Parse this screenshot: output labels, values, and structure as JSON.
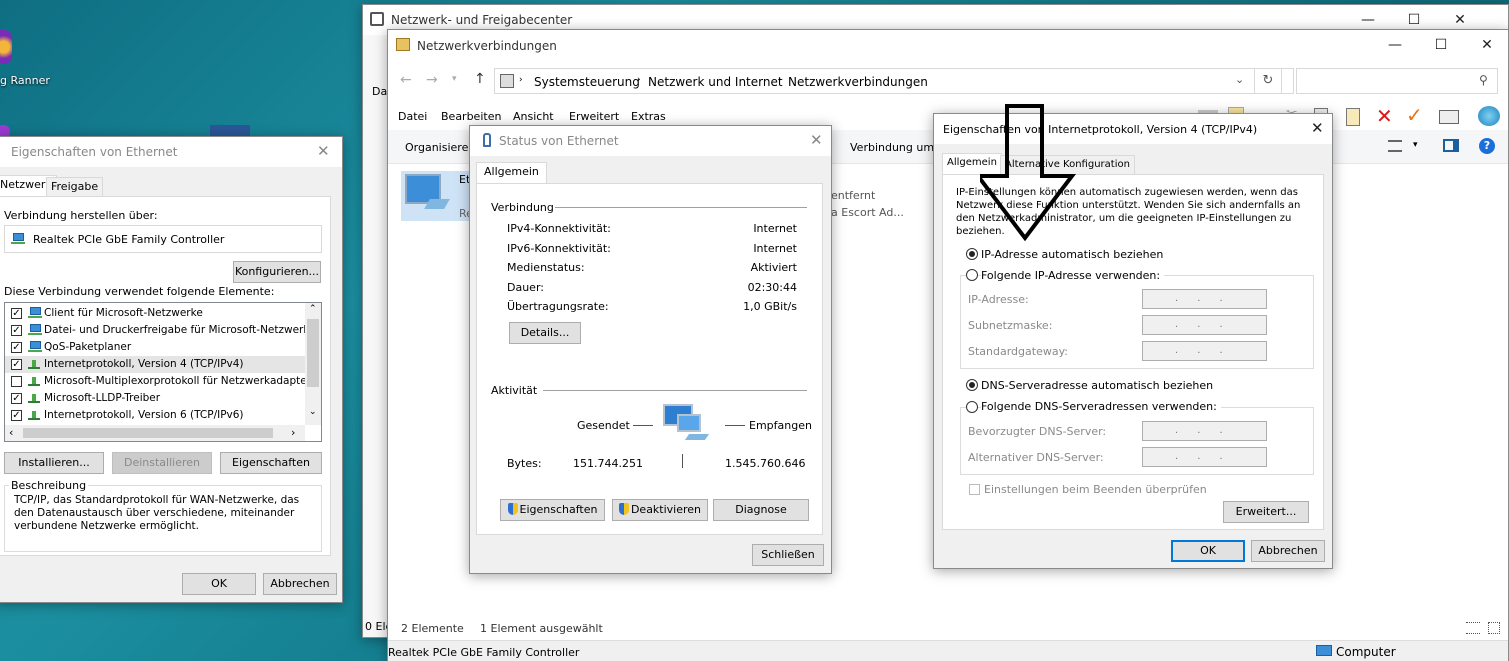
{
  "desktop": {
    "icon_label": "g Ranner"
  },
  "nfc": {
    "title": "Netzwerk- und Freigabecenter",
    "clip_text": "Dat",
    "footer_text": "0 Ele"
  },
  "nv": {
    "title": "Netzwerkverbindungen",
    "breadcrumb": [
      "Systemsteuerung",
      "Netzwerk und Internet",
      "Netzwerkverbindungen"
    ],
    "search_placeholder": "",
    "menu": [
      "Datei",
      "Bearbeiten",
      "Ansicht",
      "Erweitert",
      "Extras"
    ],
    "cmd_organize": "Organisieren",
    "cmd_remove_conn": "Verbindung umb",
    "item_clip_name": "Eth",
    "item_clip_line1": "",
    "item_clip_line2": "Re",
    "item2_line1": "entfernt",
    "item2_line2": "a Escort Ad...",
    "status_count": "2 Elemente",
    "status_selected": "1 Element ausgewählt",
    "bottom_adapter": "Realtek PCIe GbE Family Controller",
    "bottom_computer": "Computer"
  },
  "eth": {
    "title": "Eigenschaften von Ethernet",
    "tabs": [
      "Netzwerk",
      "Freigabe"
    ],
    "connect_via_label": "Verbindung herstellen über:",
    "adapter": "Realtek PCIe GbE Family Controller",
    "configure_btn": "Konfigurieren...",
    "items_label": "Diese Verbindung verwendet folgende Elemente:",
    "items": [
      {
        "label": "Client für Microsoft-Netzwerke",
        "checked": true
      },
      {
        "label": "Datei- und Druckerfreigabe für Microsoft-Netzwerke",
        "checked": true
      },
      {
        "label": "QoS-Paketplaner",
        "checked": true
      },
      {
        "label": "Internetprotokoll, Version 4 (TCP/IPv4)",
        "checked": true
      },
      {
        "label": "Microsoft-Multiplexorprotokoll für Netzwerkadapter",
        "checked": false
      },
      {
        "label": "Microsoft-LLDP-Treiber",
        "checked": true
      },
      {
        "label": "Internetprotokoll, Version 6 (TCP/IPv6)",
        "checked": true
      }
    ],
    "install_btn": "Installieren...",
    "uninstall_btn": "Deinstallieren",
    "props_btn": "Eigenschaften",
    "desc_label": "Beschreibung",
    "desc_text": "TCP/IP, das Standardprotokoll für WAN-Netzwerke, das den Datenaustausch über verschiedene, miteinander verbundene Netzwerke ermöglicht.",
    "ok_btn": "OK",
    "cancel_btn": "Abbrechen"
  },
  "status": {
    "title": "Status von Ethernet",
    "tab": "Allgemein",
    "conn_group": "Verbindung",
    "rows": [
      {
        "label": "IPv4-Konnektivität:",
        "value": "Internet"
      },
      {
        "label": "IPv6-Konnektivität:",
        "value": "Internet"
      },
      {
        "label": "Medienstatus:",
        "value": "Aktiviert"
      },
      {
        "label": "Dauer:",
        "value": "02:30:44"
      },
      {
        "label": "Übertragungsrate:",
        "value": "1,0 GBit/s"
      }
    ],
    "details_btn": "Details...",
    "activity_group": "Aktivität",
    "sent": "Gesendet",
    "received": "Empfangen",
    "bytes_label": "Bytes:",
    "bytes_sent": "151.744.251",
    "bytes_received": "1.545.760.646",
    "props_btn": "Eigenschaften",
    "disable_btn": "Deaktivieren",
    "diag_btn": "Diagnose",
    "close_btn": "Schließen"
  },
  "ipv4": {
    "title": "Eigenschaften von Internetprotokoll, Version 4 (TCP/IPv4)",
    "tabs": [
      "Allgemein",
      "Alternative Konfiguration"
    ],
    "info": "IP-Einstellungen können automatisch zugewiesen werden, wenn das Netzwerk diese Funktion unterstützt. Wenden Sie sich andernfalls an den Netzwerkadministrator, um die geeigneten IP-Einstellungen zu beziehen.",
    "radio_ip_auto": "IP-Adresse automatisch beziehen",
    "radio_ip_manual": "Folgende IP-Adresse verwenden:",
    "ip_label": "IP-Adresse:",
    "subnet_label": "Subnetzmaske:",
    "gateway_label": "Standardgateway:",
    "radio_dns_auto": "DNS-Serveradresse automatisch beziehen",
    "radio_dns_manual": "Folgende DNS-Serveradressen verwenden:",
    "dns1_label": "Bevorzugter DNS-Server:",
    "dns2_label": "Alternativer DNS-Server:",
    "validate_label": "Einstellungen beim Beenden überprüfen",
    "advanced_btn": "Erweitert...",
    "ok_btn": "OK",
    "cancel_btn": "Abbrechen",
    "ip_placeholder": ".      .      ."
  }
}
